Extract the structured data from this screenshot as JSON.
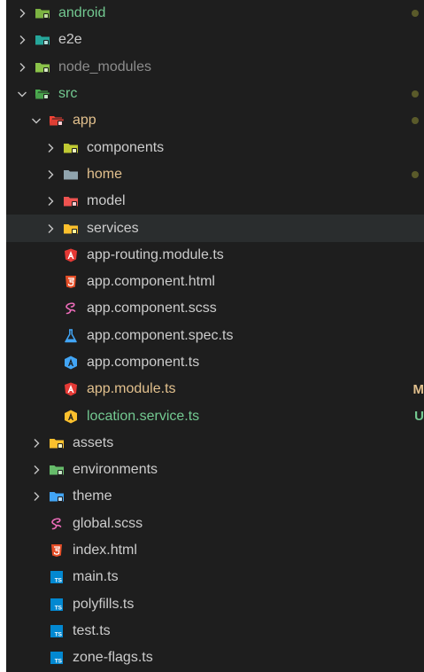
{
  "explorer": {
    "rows": [
      {
        "label": "android",
        "type": "folder",
        "depth": 0,
        "icon": "android-folder-icon",
        "icon_color": "#7cb342",
        "label_color": "green",
        "decoration": "dot"
      },
      {
        "label": "e2e",
        "type": "folder",
        "depth": 0,
        "icon": "e2e-folder-icon",
        "icon_color": "#26a69a",
        "label_color": "default",
        "decoration": ""
      },
      {
        "label": "node_modules",
        "type": "folder",
        "depth": 0,
        "icon": "node-modules-folder-icon",
        "icon_color": "#8bc34a",
        "label_color": "dim",
        "decoration": ""
      },
      {
        "label": "src",
        "type": "folder-open",
        "depth": 0,
        "icon": "src-folder-icon",
        "icon_color": "#4caf50",
        "label_color": "green",
        "decoration": "dot"
      },
      {
        "label": "app",
        "type": "folder-open",
        "depth": 1,
        "icon": "app-folder-icon",
        "icon_color": "#f44336",
        "label_color": "modified",
        "decoration": "dot"
      },
      {
        "label": "components",
        "type": "folder",
        "depth": 2,
        "icon": "components-folder-icon",
        "icon_color": "#c0ca33",
        "label_color": "default",
        "decoration": ""
      },
      {
        "label": "home",
        "type": "folder",
        "depth": 2,
        "icon": "home-folder-icon",
        "icon_color": "#90a4ae",
        "label_color": "modified",
        "decoration": "dot"
      },
      {
        "label": "model",
        "type": "folder",
        "depth": 2,
        "icon": "model-folder-icon",
        "icon_color": "#ef5350",
        "label_color": "default",
        "decoration": ""
      },
      {
        "label": "services",
        "type": "folder",
        "depth": 2,
        "icon": "services-folder-icon",
        "icon_color": "#fbc02d",
        "label_color": "default",
        "decoration": "",
        "selected": true
      },
      {
        "label": "app-routing.module.ts",
        "type": "file",
        "depth": 2,
        "icon": "angular-routing-icon",
        "icon_color": "#e53935",
        "label_color": "default",
        "decoration": ""
      },
      {
        "label": "app.component.html",
        "type": "file",
        "depth": 2,
        "icon": "html-icon",
        "icon_color": "#e44d26",
        "label_color": "default",
        "decoration": ""
      },
      {
        "label": "app.component.scss",
        "type": "file",
        "depth": 2,
        "icon": "sass-icon",
        "icon_color": "#ec6cb9",
        "label_color": "default",
        "decoration": ""
      },
      {
        "label": "app.component.spec.ts",
        "type": "file",
        "depth": 2,
        "icon": "test-flask-icon",
        "icon_color": "#42a5f5",
        "label_color": "default",
        "decoration": ""
      },
      {
        "label": "app.component.ts",
        "type": "file",
        "depth": 2,
        "icon": "angular-component-icon",
        "icon_color": "#42a5f5",
        "label_color": "default",
        "decoration": ""
      },
      {
        "label": "app.module.ts",
        "type": "file",
        "depth": 2,
        "icon": "angular-module-icon",
        "icon_color": "#e53935",
        "label_color": "modified",
        "decoration": "M"
      },
      {
        "label": "location.service.ts",
        "type": "file",
        "depth": 2,
        "icon": "angular-service-icon",
        "icon_color": "#fbc02d",
        "label_color": "untracked",
        "decoration": "U"
      },
      {
        "label": "assets",
        "type": "folder",
        "depth": 1,
        "icon": "assets-folder-icon",
        "icon_color": "#fbc02d",
        "label_color": "default",
        "decoration": ""
      },
      {
        "label": "environments",
        "type": "folder",
        "depth": 1,
        "icon": "environments-folder-icon",
        "icon_color": "#66bb6a",
        "label_color": "default",
        "decoration": ""
      },
      {
        "label": "theme",
        "type": "folder",
        "depth": 1,
        "icon": "theme-folder-icon",
        "icon_color": "#42a5f5",
        "label_color": "default",
        "decoration": ""
      },
      {
        "label": "global.scss",
        "type": "file",
        "depth": 1,
        "icon": "sass-icon",
        "icon_color": "#ec6cb9",
        "label_color": "default",
        "decoration": ""
      },
      {
        "label": "index.html",
        "type": "file",
        "depth": 1,
        "icon": "html-icon",
        "icon_color": "#e44d26",
        "label_color": "default",
        "decoration": ""
      },
      {
        "label": "main.ts",
        "type": "file",
        "depth": 1,
        "icon": "typescript-icon",
        "icon_color": "#0288d1",
        "label_color": "default",
        "decoration": ""
      },
      {
        "label": "polyfills.ts",
        "type": "file",
        "depth": 1,
        "icon": "typescript-icon",
        "icon_color": "#0288d1",
        "label_color": "default",
        "decoration": ""
      },
      {
        "label": "test.ts",
        "type": "file",
        "depth": 1,
        "icon": "typescript-icon",
        "icon_color": "#0288d1",
        "label_color": "default",
        "decoration": ""
      },
      {
        "label": "zone-flags.ts",
        "type": "file",
        "depth": 1,
        "icon": "typescript-icon",
        "icon_color": "#0288d1",
        "label_color": "default",
        "decoration": ""
      }
    ]
  }
}
